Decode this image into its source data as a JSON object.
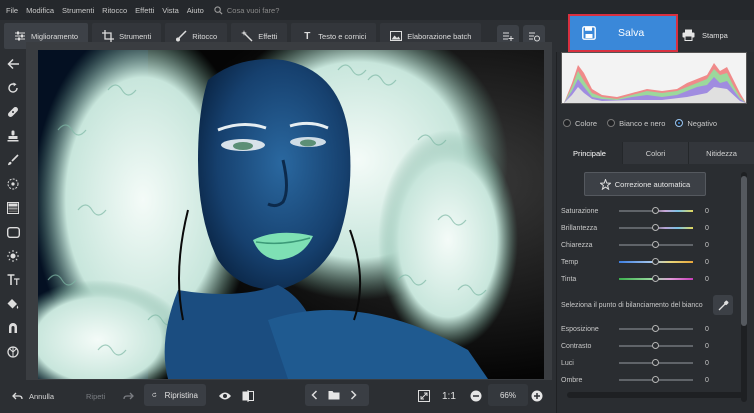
{
  "menubar": {
    "items": [
      "File",
      "Modifica",
      "Strumenti",
      "Ritocco",
      "Effetti",
      "Vista",
      "Aiuto"
    ],
    "search_placeholder": "Cosa vuoi fare?"
  },
  "toolbar": {
    "tabs": [
      "Miglioramento",
      "Strumenti",
      "Ritocco",
      "Effetti",
      "Testo e cornici",
      "Elaborazione batch"
    ]
  },
  "save_label": "Salva",
  "print_label": "Stampa",
  "colors": {
    "accent": "#3a88d9",
    "highlight_border": "#d93040",
    "panel": "#2a2d31",
    "background": "#2c2f33"
  },
  "color_modes": {
    "options": [
      "Colore",
      "Bianco e nero",
      "Negativo"
    ],
    "selected": "Negativo"
  },
  "panel_tabs": {
    "items": [
      "Principale",
      "Colori",
      "Nitidezza"
    ],
    "active": "Principale"
  },
  "autofix_label": "Correzione automatica",
  "sliders": [
    {
      "label": "Saturazione",
      "value": "0"
    },
    {
      "label": "Brillantezza",
      "value": "0"
    },
    {
      "label": "Chiarezza",
      "value": "0"
    },
    {
      "label": "Temp",
      "value": "0"
    },
    {
      "label": "Tinta",
      "value": "0"
    }
  ],
  "white_balance_label": "Seleziona il punto di bilanciamento del bianco",
  "sliders2": [
    {
      "label": "Esposizione",
      "value": "0"
    },
    {
      "label": "Contrasto",
      "value": "0"
    },
    {
      "label": "Luci",
      "value": "0"
    },
    {
      "label": "Ombre",
      "value": "0"
    }
  ],
  "bottom": {
    "undo": "Annulla",
    "redo": "Ripeti",
    "reset": "Ripristina",
    "zoom_ratio": "1:1",
    "zoom": "66%"
  }
}
